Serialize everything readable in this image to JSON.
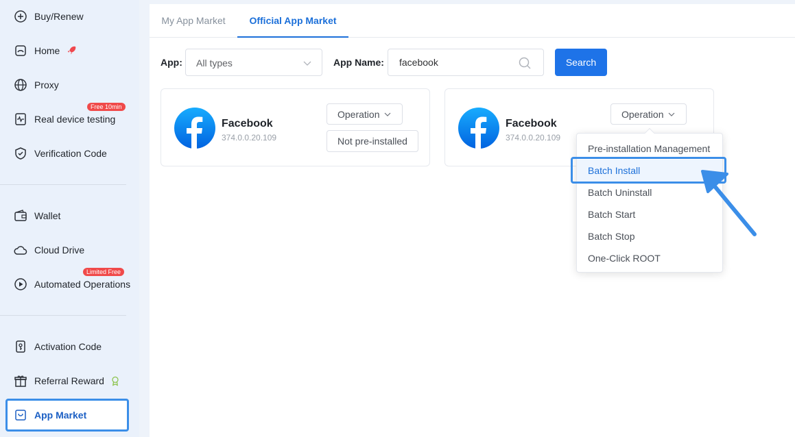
{
  "sidebar": {
    "items": [
      {
        "label": "Buy/Renew",
        "icon": "plus-circle-icon"
      },
      {
        "label": "Home",
        "icon": "home-icon"
      },
      {
        "label": "Proxy",
        "icon": "globe-icon"
      },
      {
        "label": "Real device testing",
        "icon": "pulse-icon",
        "badge": "Free 10min"
      },
      {
        "label": "Verification Code",
        "icon": "shield-check-icon"
      },
      {
        "label": "Wallet",
        "icon": "wallet-icon"
      },
      {
        "label": "Cloud Drive",
        "icon": "cloud-icon"
      },
      {
        "label": "Automated Operations",
        "icon": "play-circle-icon",
        "badge": "Limited Free"
      },
      {
        "label": "Activation Code",
        "icon": "key-icon"
      },
      {
        "label": "Referral Reward",
        "icon": "gift-icon"
      },
      {
        "label": "App Market",
        "icon": "bag-icon",
        "active": true
      }
    ]
  },
  "tabs": [
    {
      "label": "My App Market"
    },
    {
      "label": "Official App Market",
      "active": true
    }
  ],
  "filters": {
    "app_label": "App:",
    "app_value": "All types",
    "name_label": "App Name:",
    "name_value": "facebook",
    "search_label": "Search"
  },
  "cards": [
    {
      "name": "Facebook",
      "version": "374.0.0.20.109",
      "operation": "Operation",
      "status": "Not pre-installed"
    },
    {
      "name": "Facebook",
      "version": "374.0.0.20.109",
      "operation": "Operation"
    }
  ],
  "dropdown": {
    "items": [
      {
        "label": "Pre-installation Management"
      },
      {
        "label": "Batch Install",
        "highlighted": true
      },
      {
        "label": "Batch Uninstall"
      },
      {
        "label": "Batch Start"
      },
      {
        "label": "Batch Stop"
      },
      {
        "label": "One-Click ROOT"
      }
    ]
  },
  "colors": {
    "accent": "#1e73e8",
    "highlight_border": "#3b8ee8",
    "badge": "#f04a4a",
    "sidebar_bg": "#eaf1fb"
  }
}
